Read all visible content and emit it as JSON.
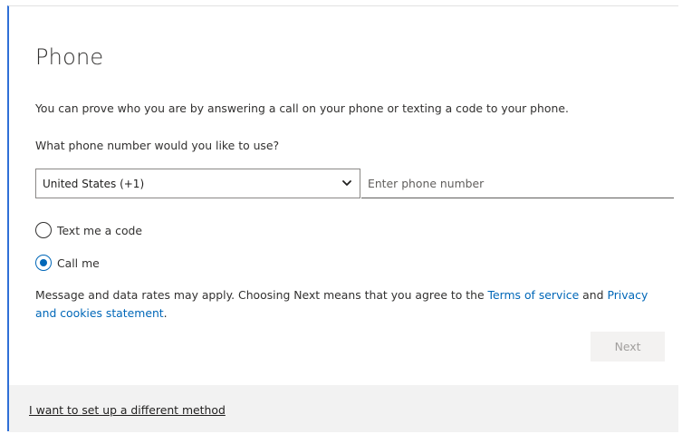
{
  "page": {
    "title": "Phone",
    "description": "You can prove who you are by answering a call on your phone or texting a code to your phone.",
    "question": "What phone number would you like to use?"
  },
  "form": {
    "country": "United States (+1)",
    "phone_value": "",
    "phone_placeholder": "Enter phone number",
    "options": [
      {
        "label": "Text me a code",
        "selected": false
      },
      {
        "label": "Call me",
        "selected": true
      }
    ]
  },
  "notice": {
    "prefix": "Message and data rates may apply. Choosing Next means that you agree to the ",
    "terms_link": "Terms of service",
    "middle": " and ",
    "privacy_link": "Privacy and cookies statement",
    "suffix": "."
  },
  "actions": {
    "next_label": "Next"
  },
  "footer": {
    "alt_method_link": "I want to set up a different method"
  },
  "colors": {
    "accent": "#0067b8",
    "window_border": "#2f6fd6",
    "disabled_button_bg": "#f3f2f1",
    "footer_bg": "#f2f2f2"
  },
  "icons": {
    "dropdown": "chevron-down-icon"
  }
}
